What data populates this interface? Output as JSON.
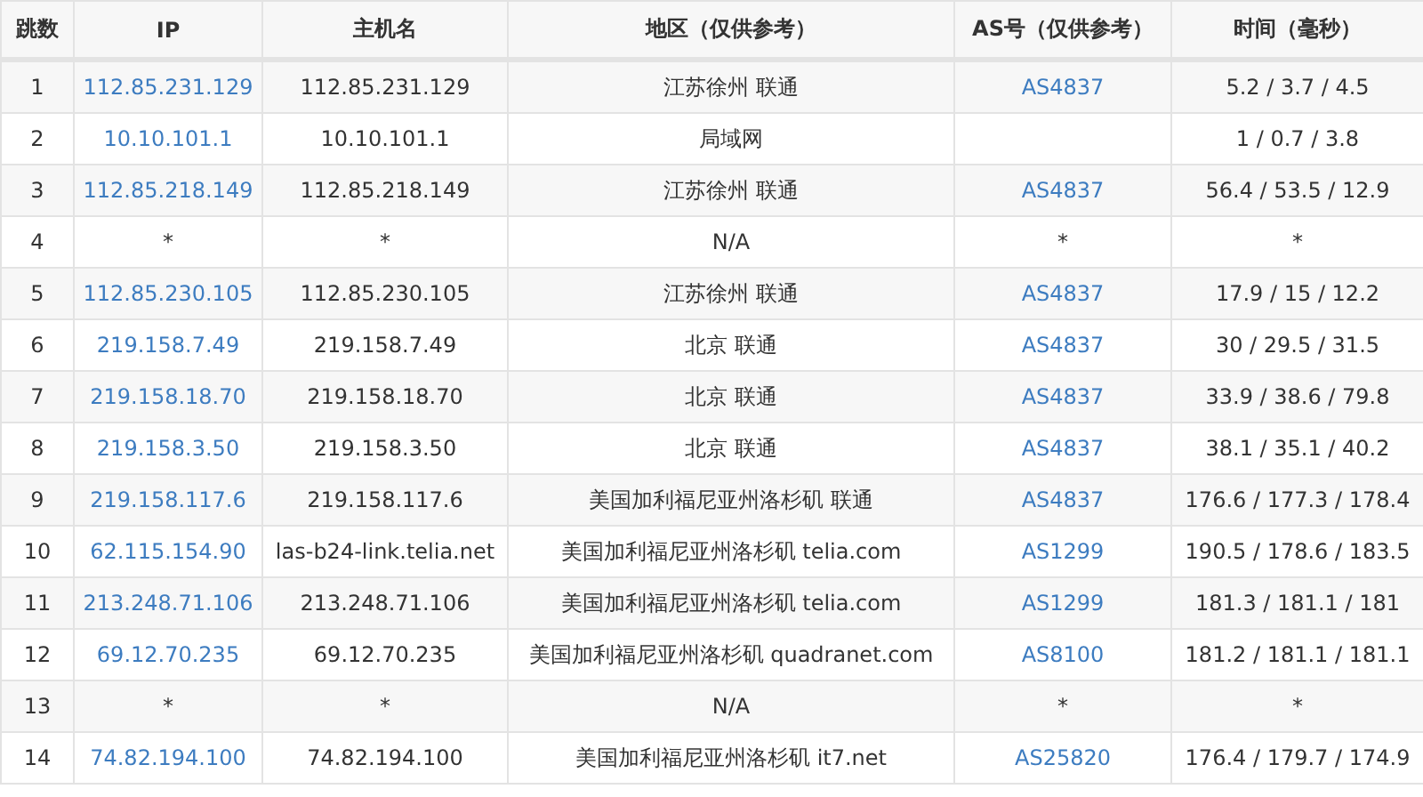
{
  "table": {
    "columns": [
      "跳数",
      "IP",
      "主机名",
      "地区（仅供参考）",
      "AS号（仅供参考）",
      "时间（毫秒）"
    ],
    "rows": [
      {
        "hop": "1",
        "ip": "112.85.231.129",
        "linked": true,
        "host": "112.85.231.129",
        "region": "江苏徐州 联通",
        "as": "AS4837",
        "time": "5.2 / 3.7 / 4.5"
      },
      {
        "hop": "2",
        "ip": "10.10.101.1",
        "linked": true,
        "host": "10.10.101.1",
        "region": "局域网",
        "time": "1 / 0.7 / 3.8"
      },
      {
        "hop": "3",
        "ip": "112.85.218.149",
        "linked": true,
        "host": "112.85.218.149",
        "region": "江苏徐州 联通",
        "as": "AS4837",
        "time": "56.4 / 53.5 / 12.9"
      },
      {
        "hop": "4",
        "ip": "*",
        "linked": false,
        "host": "*",
        "region": "N/A",
        "as": "*",
        "time": "*"
      },
      {
        "hop": "5",
        "ip": "112.85.230.105",
        "linked": true,
        "host": "112.85.230.105",
        "region": "江苏徐州 联通",
        "as": "AS4837",
        "time": "17.9 / 15 / 12.2"
      },
      {
        "hop": "6",
        "ip": "219.158.7.49",
        "linked": true,
        "host": "219.158.7.49",
        "region": "北京 联通",
        "as": "AS4837",
        "time": "30 / 29.5 / 31.5"
      },
      {
        "hop": "7",
        "ip": "219.158.18.70",
        "linked": true,
        "host": "219.158.18.70",
        "region": "北京 联通",
        "as": "AS4837",
        "time": "33.9 / 38.6 / 79.8"
      },
      {
        "hop": "8",
        "ip": "219.158.3.50",
        "linked": true,
        "host": "219.158.3.50",
        "region": "北京 联通",
        "as": "AS4837",
        "time": "38.1 / 35.1 / 40.2"
      },
      {
        "hop": "9",
        "ip": "219.158.117.6",
        "linked": true,
        "host": "219.158.117.6",
        "region": "美国加利福尼亚州洛杉矶 联通",
        "as": "AS4837",
        "time": "176.6 / 177.3 / 178.4"
      },
      {
        "hop": "10",
        "ip": "62.115.154.90",
        "linked": true,
        "host": "las-b24-link.telia.net",
        "region": "美国加利福尼亚州洛杉矶 telia.com",
        "as": "AS1299",
        "time": "190.5 / 178.6 / 183.5"
      },
      {
        "hop": "11",
        "ip": "213.248.71.106",
        "linked": true,
        "host": "213.248.71.106",
        "region": "美国加利福尼亚州洛杉矶 telia.com",
        "as": "AS1299",
        "time": "181.3 / 181.1 / 181"
      },
      {
        "hop": "12",
        "ip": "69.12.70.235",
        "linked": true,
        "host": "69.12.70.235",
        "region": "美国加利福尼亚州洛杉矶 quadranet.com",
        "as": "AS8100",
        "time": "181.2 / 181.1 / 181.1"
      },
      {
        "hop": "13",
        "ip": "*",
        "linked": false,
        "host": "*",
        "region": "N/A",
        "as": "*",
        "time": "*"
      },
      {
        "hop": "14",
        "ip": "74.82.194.100",
        "linked": true,
        "host": "74.82.194.100",
        "region": "美国加利福尼亚州洛杉矶 it7.net",
        "as": "AS25820",
        "time": "176.4 / 179.7 / 174.9"
      }
    ]
  }
}
